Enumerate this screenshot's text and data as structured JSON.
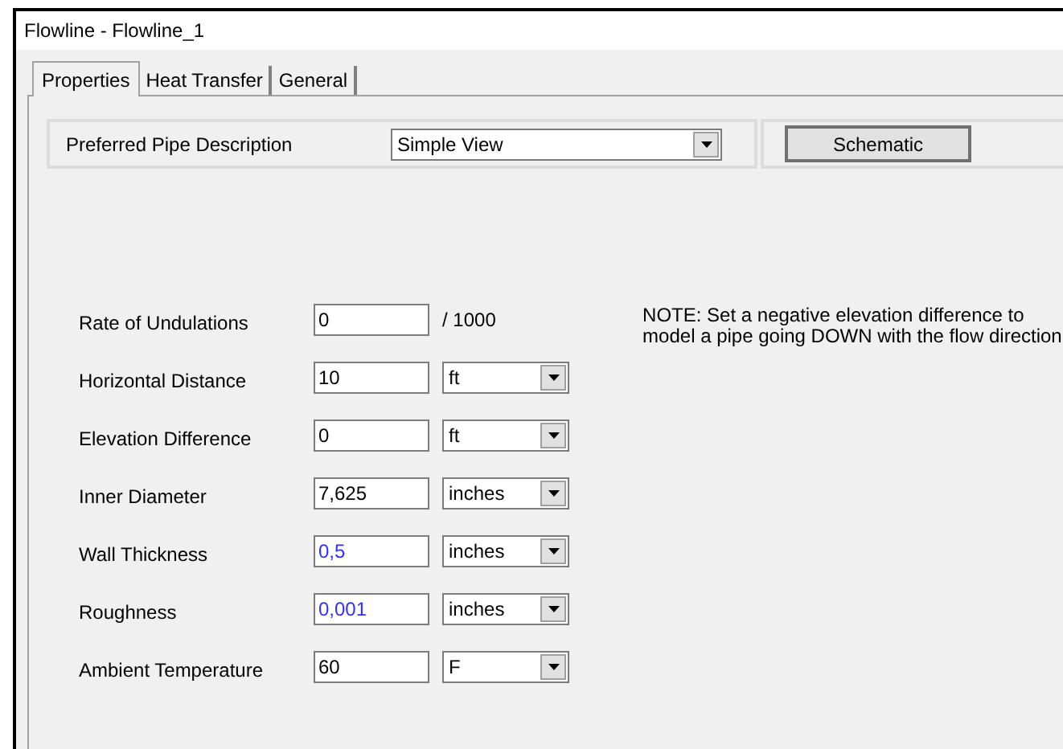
{
  "window": {
    "title": "Flowline - Flowline_1"
  },
  "tabs": [
    {
      "label": "Properties",
      "selected": true
    },
    {
      "label": "Heat Transfer",
      "selected": false
    },
    {
      "label": "General",
      "selected": false
    }
  ],
  "description": {
    "label": "Preferred Pipe Description",
    "value": "Simple View"
  },
  "schematic_button": "Schematic",
  "note": "NOTE: Set a negative elevation difference to model a pipe going DOWN with the flow direction",
  "fields": [
    {
      "label": "Rate of Undulations",
      "value": "0",
      "modified": false,
      "kind": "suffix",
      "unit": "/ 1000"
    },
    {
      "label": "Horizontal Distance",
      "value": "10",
      "modified": false,
      "kind": "unit",
      "unit": "ft"
    },
    {
      "label": "Elevation Difference",
      "value": "0",
      "modified": false,
      "kind": "unit",
      "unit": "ft"
    },
    {
      "label": "Inner Diameter",
      "value": "7,625",
      "modified": false,
      "kind": "unit",
      "unit": "inches"
    },
    {
      "label": "Wall Thickness",
      "value": "0,5",
      "modified": true,
      "kind": "unit",
      "unit": "inches"
    },
    {
      "label": "Roughness",
      "value": "0,001",
      "modified": true,
      "kind": "unit",
      "unit": "inches"
    },
    {
      "label": "Ambient Temperature",
      "value": "60",
      "modified": false,
      "kind": "unit",
      "unit": "F"
    }
  ]
}
